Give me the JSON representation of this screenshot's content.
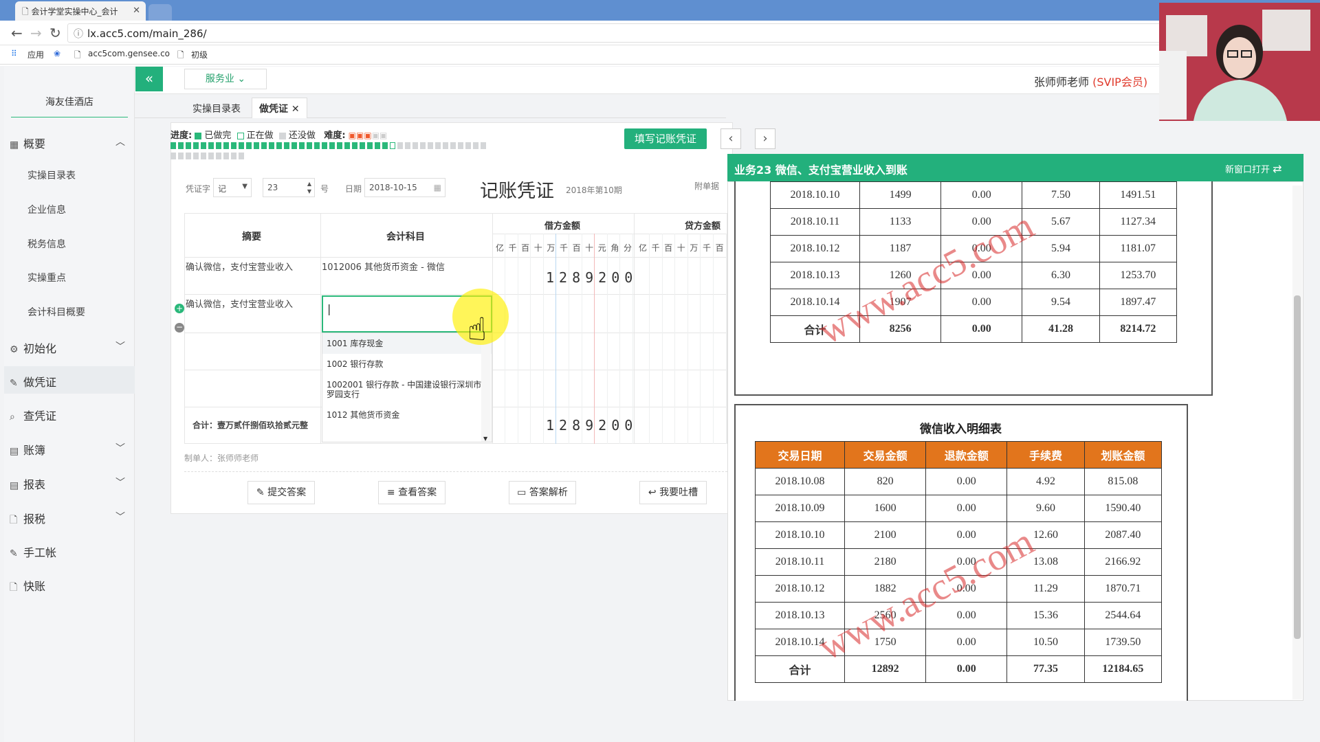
{
  "browser": {
    "tab_title": "会计学堂实操中心_会计",
    "url": "lx.acc5.com/main_286/",
    "bookmarks": [
      "应用",
      "acc5com.gensee.co",
      "初级"
    ]
  },
  "sidebar": {
    "company": "海友佳酒店",
    "menu": [
      {
        "label": "概要"
      },
      {
        "label": "初始化"
      },
      {
        "label": "做凭证"
      },
      {
        "label": "查凭证"
      },
      {
        "label": "账簿"
      },
      {
        "label": "报表"
      },
      {
        "label": "报税"
      },
      {
        "label": "手工帐"
      },
      {
        "label": "快账"
      }
    ],
    "sub_items": [
      "实操目录表",
      "企业信息",
      "税务信息",
      "实操重点",
      "会计科目概要"
    ]
  },
  "topbar": {
    "industry": "服务业",
    "user_name": "张师师老师",
    "user_level": "(SVIP会员)"
  },
  "page_tabs": [
    "实操目录表",
    "做凭证"
  ],
  "progress": {
    "label": "进度:",
    "done": "已做完",
    "doing": "正在做",
    "todo": "还没做",
    "difficulty_label": "难度:",
    "done_count": 29,
    "total_count": 42,
    "second_row_count": 10
  },
  "fill_button": "填写记账凭证",
  "voucher": {
    "type_label": "凭证字",
    "type_value": "记",
    "number": "23",
    "number_suffix": "号",
    "date_label": "日期",
    "date_value": "2018-10-15",
    "title": "记账凭证",
    "period": "2018年第10期",
    "attachments_label": "附单据",
    "col_summary": "摘要",
    "col_account": "会计科目",
    "col_debit": "借方金额",
    "col_credit": "贷方金额",
    "digits": [
      "亿",
      "千",
      "百",
      "十",
      "万",
      "千",
      "百",
      "十",
      "元",
      "角",
      "分"
    ],
    "credit_digits": [
      "亿",
      "千",
      "百",
      "十",
      "万",
      "千",
      "百"
    ],
    "rows": [
      {
        "summary": "确认微信，支付宝营业收入",
        "account": "1012006 其他货币资金 - 微信",
        "debit": "1289200"
      },
      {
        "summary": "确认微信，支付宝营业收入",
        "account": "",
        "debit": ""
      }
    ],
    "total_label": "合计：壹万贰仟捌佰玖拾贰元整",
    "total_debit": "1289200",
    "preparer": "制单人：张师师老师",
    "dropdown": [
      "1001 库存现金",
      "1002 银行存款",
      "1002001 银行存款 - 中国建设银行深圳市罗园支行",
      "1012 其他货币资金"
    ]
  },
  "actions": [
    "提交答案",
    "查看答案",
    "答案解析",
    "我要吐槽"
  ],
  "overlay": {
    "title": "业务23 微信、支付宝营业收入到账",
    "new_window": "新窗口打开",
    "watermark": "www.acc5.com",
    "table1": {
      "rows": [
        [
          "2018.10.10",
          "1499",
          "0.00",
          "7.50",
          "1491.51"
        ],
        [
          "2018.10.11",
          "1133",
          "0.00",
          "5.67",
          "1127.34"
        ],
        [
          "2018.10.12",
          "1187",
          "0.00",
          "5.94",
          "1181.07"
        ],
        [
          "2018.10.13",
          "1260",
          "0.00",
          "6.30",
          "1253.70"
        ],
        [
          "2018.10.14",
          "1907",
          "0.00",
          "9.54",
          "1897.47"
        ]
      ],
      "total": [
        "合计",
        "8256",
        "0.00",
        "41.28",
        "8214.72"
      ]
    },
    "table2": {
      "title": "微信收入明细表",
      "headers": [
        "交易日期",
        "交易金额",
        "退款金额",
        "手续费",
        "划账金额"
      ],
      "rows": [
        [
          "2018.10.08",
          "820",
          "0.00",
          "4.92",
          "815.08"
        ],
        [
          "2018.10.09",
          "1600",
          "0.00",
          "9.60",
          "1590.40"
        ],
        [
          "2018.10.10",
          "2100",
          "0.00",
          "12.60",
          "2087.40"
        ],
        [
          "2018.10.11",
          "2180",
          "0.00",
          "13.08",
          "2166.92"
        ],
        [
          "2018.10.12",
          "1882",
          "0.00",
          "11.29",
          "1870.71"
        ],
        [
          "2018.10.13",
          "2560",
          "0.00",
          "15.36",
          "2544.64"
        ],
        [
          "2018.10.14",
          "1750",
          "0.00",
          "10.50",
          "1739.50"
        ]
      ],
      "total": [
        "合计",
        "12892",
        "0.00",
        "77.35",
        "12184.65"
      ]
    }
  },
  "colors": {
    "accent": "#23b07c",
    "table_header": "#e2751c",
    "svip": "#e0392b",
    "watermark": "#d72828"
  }
}
